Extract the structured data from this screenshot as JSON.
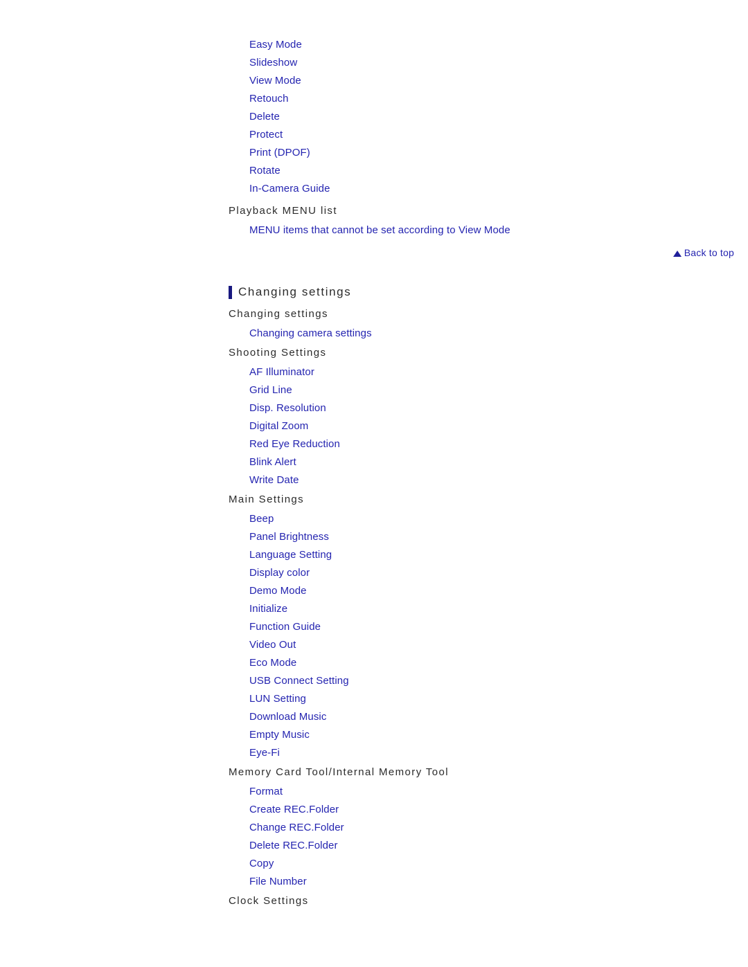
{
  "playback_section": {
    "links": [
      "Easy Mode",
      "Slideshow",
      "View Mode",
      "Retouch",
      "Delete",
      "Protect",
      "Print (DPOF)",
      "Rotate",
      "In-Camera Guide"
    ],
    "heading": "Playback MENU list",
    "sub_links": [
      "MENU items that cannot be set according to View Mode"
    ]
  },
  "back_to_top": {
    "label": "Back to top",
    "icon": "triangle-up-icon"
  },
  "changing_settings": {
    "main_heading": "Changing settings",
    "groups": [
      {
        "heading": "Changing settings",
        "links": [
          "Changing camera settings"
        ]
      },
      {
        "heading": "Shooting Settings",
        "links": [
          "AF Illuminator",
          "Grid Line",
          "Disp. Resolution",
          "Digital Zoom",
          "Red Eye Reduction",
          "Blink Alert",
          "Write Date"
        ]
      },
      {
        "heading": "Main Settings",
        "links": [
          "Beep",
          "Panel Brightness",
          "Language Setting",
          "Display color",
          "Demo Mode",
          "Initialize",
          "Function Guide",
          "Video Out",
          "Eco Mode",
          "USB Connect Setting",
          "LUN Setting",
          "Download Music",
          "Empty Music",
          "Eye-Fi"
        ]
      },
      {
        "heading": "Memory Card Tool/Internal Memory Tool",
        "links": [
          "Format",
          "Create REC.Folder",
          "Change REC.Folder",
          "Delete REC.Folder",
          "Copy",
          "File Number"
        ]
      },
      {
        "heading": "Clock Settings",
        "links": []
      }
    ]
  },
  "colors": {
    "link": "#2424b0",
    "heading": "#2b2b2b",
    "accent_bar": "#191980",
    "background": "#ffffff"
  }
}
